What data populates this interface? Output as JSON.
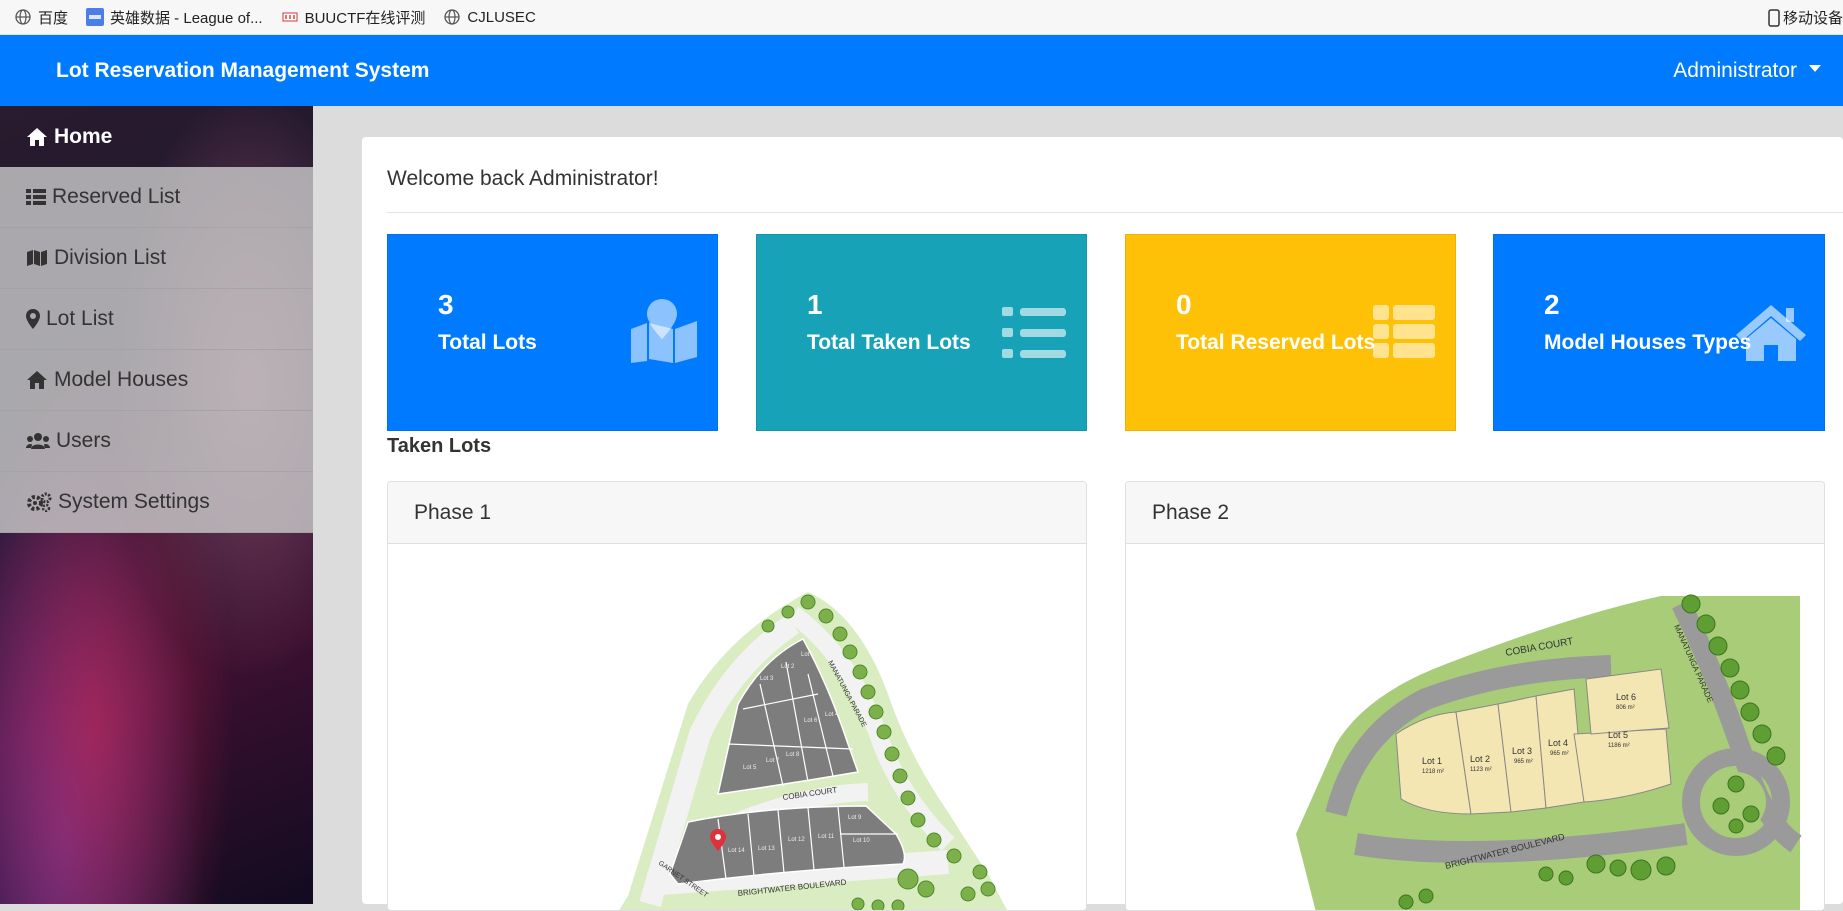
{
  "bookmarks": {
    "items": [
      {
        "label": "百度",
        "icon": "globe-icon"
      },
      {
        "label": "英雄数据 - League of...",
        "icon": "opgg-icon"
      },
      {
        "label": "BUUCTF在线评测",
        "icon": "buuctf-icon"
      },
      {
        "label": "CJLUSEC",
        "icon": "globe-icon"
      }
    ],
    "mobile": "移动设备"
  },
  "navbar": {
    "brand": "Lot Reservation Management System",
    "user": "Administrator"
  },
  "sidebar": {
    "items": [
      {
        "label": "Home",
        "icon": "home-icon",
        "active": true
      },
      {
        "label": "Reserved List",
        "icon": "list-icon"
      },
      {
        "label": "Division List",
        "icon": "map-icon"
      },
      {
        "label": "Lot List",
        "icon": "map-marker-icon"
      },
      {
        "label": "Model Houses",
        "icon": "home-icon"
      },
      {
        "label": "Users",
        "icon": "users-icon"
      },
      {
        "label": "System Settings",
        "icon": "cogs-icon"
      }
    ]
  },
  "main": {
    "welcome": "Welcome back Administrator!",
    "stats": [
      {
        "value": "3",
        "label": "Total Lots",
        "icon": "map-icon",
        "color": "#007bff"
      },
      {
        "value": "1",
        "label": "Total Taken Lots",
        "icon": "list-icon",
        "color": "#17a2b8"
      },
      {
        "value": "0",
        "label": "Total Reserved Lots",
        "icon": "th-list-icon",
        "color": "#ffc107"
      },
      {
        "value": "2",
        "label": "Model Houses Types",
        "icon": "home-icon",
        "color": "#007bff"
      }
    ],
    "taken_title": "Taken Lots",
    "phases": [
      {
        "title": "Phase 1",
        "streets": [
          "COBIA COURT",
          "MANATUNGA PARADE",
          "GARNET STREET",
          "BRIGHTWATER BOULEVARD"
        ],
        "lots": [
          "Lot 1",
          "Lot 2",
          "Lot 3",
          "Lot 4",
          "Lot 5",
          "Lot 6",
          "Lot 7",
          "Lot 8",
          "Lot 9",
          "Lot 10",
          "Lot 11",
          "Lot 12",
          "Lot 13",
          "Lot 14"
        ]
      },
      {
        "title": "Phase 2",
        "streets": [
          "COBIA COURT",
          "MANATUNGA PARADE",
          "BRIGHTWATER BOULEVARD"
        ],
        "lots": [
          {
            "name": "Lot 1",
            "area": "1218 m²"
          },
          {
            "name": "Lot 2",
            "area": "1123 m²"
          },
          {
            "name": "Lot 3",
            "area": "965 m²"
          },
          {
            "name": "Lot 4",
            "area": "965 m²"
          },
          {
            "name": "Lot 5",
            "area": "1186 m²"
          },
          {
            "name": "Lot 6",
            "area": "806 m²"
          }
        ]
      }
    ]
  },
  "colors": {
    "primary": "#007bff",
    "info": "#17a2b8",
    "warning": "#ffc107",
    "marker": "#e0303a"
  }
}
